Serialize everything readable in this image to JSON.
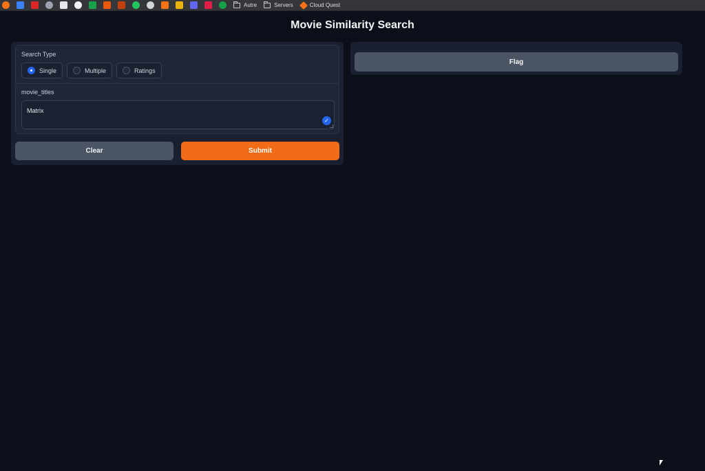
{
  "browser": {
    "bookmarks": [
      {
        "icon": "firefox-icon",
        "color": "#f97316"
      },
      {
        "icon": "app-icon",
        "color": "#3b82f6"
      },
      {
        "icon": "yt-icon",
        "color": "#dc2626"
      },
      {
        "icon": "network-icon",
        "color": "#9ca3af"
      },
      {
        "icon": "printer-icon",
        "color": "#e5e7eb"
      },
      {
        "icon": "github-icon",
        "color": "#f3f4f6"
      },
      {
        "icon": "sheets-icon",
        "color": "#16a34a"
      },
      {
        "icon": "tool-icon",
        "color": "#ea580c"
      },
      {
        "icon": "tool2-icon",
        "color": "#ea580c"
      },
      {
        "icon": "whatsapp-icon",
        "color": "#22c55e"
      },
      {
        "icon": "alien-icon",
        "color": "#d1d5db"
      },
      {
        "icon": "x-icon",
        "color": "#f97316"
      },
      {
        "icon": "diamond-icon",
        "color": "#eab308"
      },
      {
        "icon": "square-icon",
        "color": "#6366f1"
      },
      {
        "icon": "square2-icon",
        "color": "#e11d48"
      },
      {
        "icon": "leaf-icon",
        "color": "#16a34a"
      }
    ],
    "folders": [
      "Autre",
      "Servers"
    ],
    "cloud_quest": "Cloud Quest"
  },
  "page": {
    "title": "Movie Similarity Search"
  },
  "form": {
    "search_type_label": "Search Type",
    "options": [
      {
        "label": "Single",
        "selected": true
      },
      {
        "label": "Multiple",
        "selected": false
      },
      {
        "label": "Ratings",
        "selected": false
      }
    ],
    "titles_label": "movie_titles",
    "titles_value": "Matrix",
    "clear_label": "Clear",
    "submit_label": "Submit"
  },
  "output": {
    "flag_label": "Flag"
  },
  "colors": {
    "accent": "#f26b16",
    "radio_active": "#2563eb",
    "background": "#0b0f19"
  }
}
